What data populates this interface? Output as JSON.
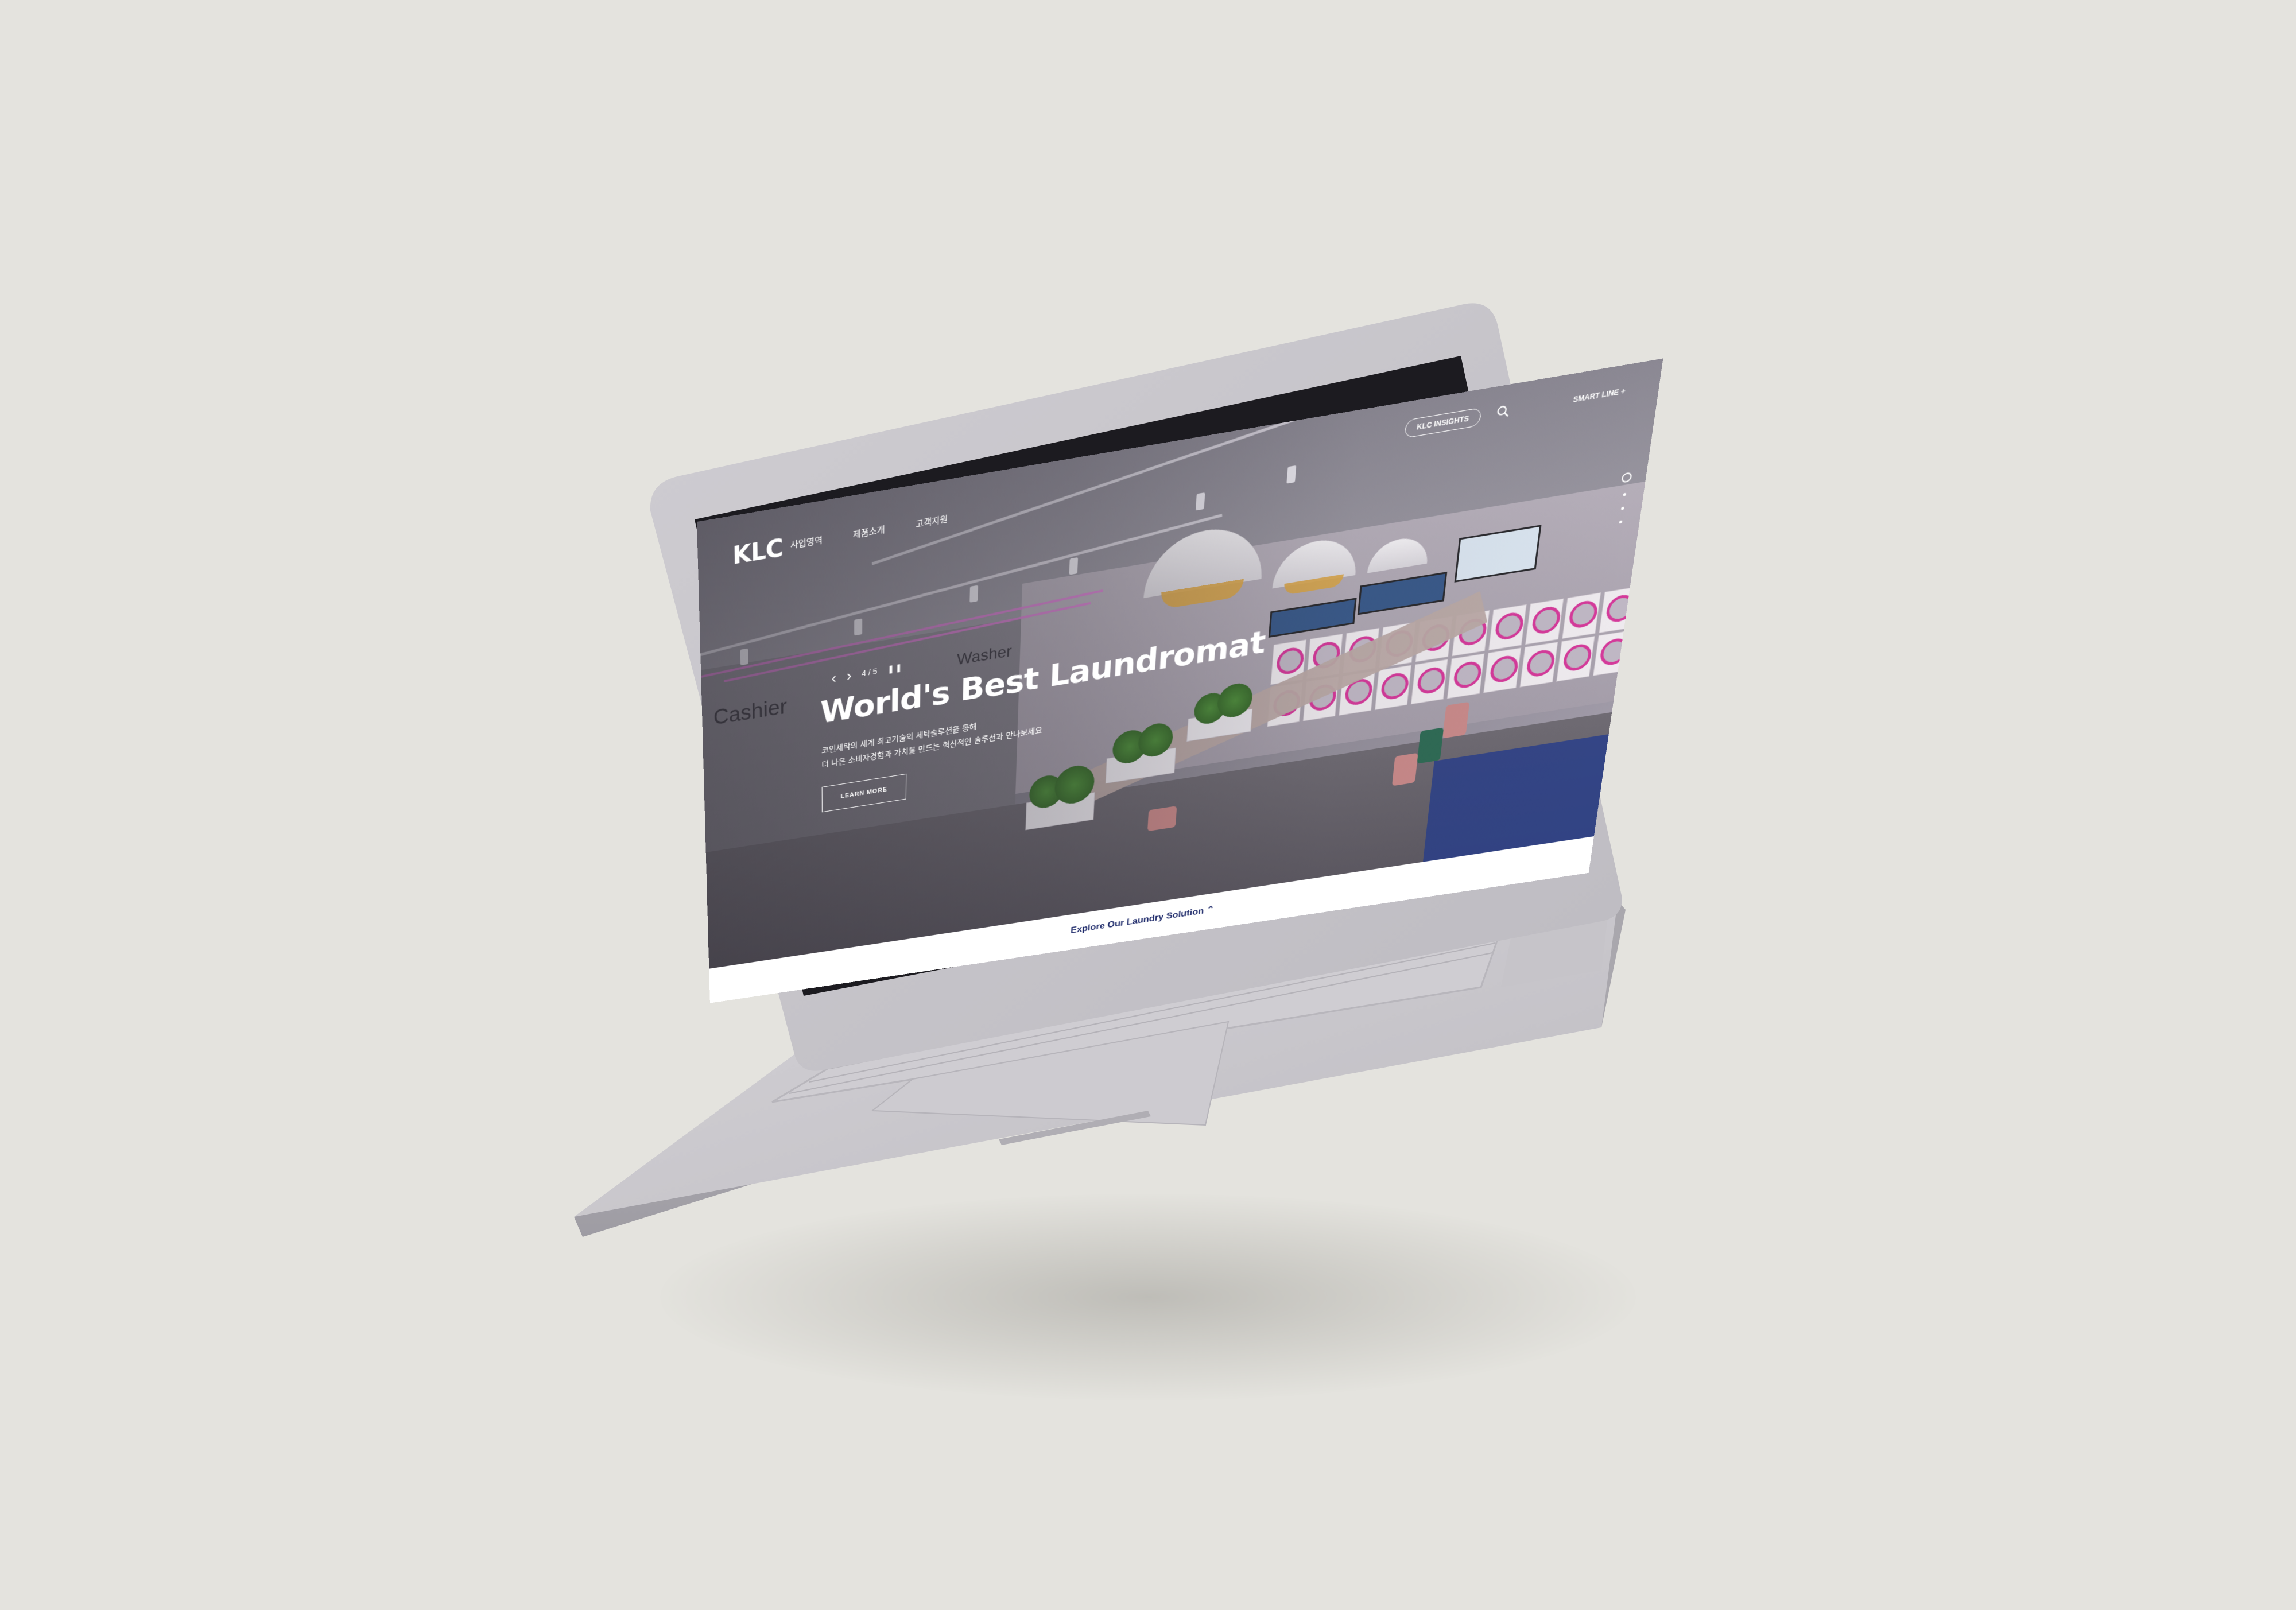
{
  "header": {
    "logo": "KLC",
    "nav": [
      "사업영역",
      "제품소개",
      "고객지원"
    ],
    "insights_label": "KLC INSIGHTS",
    "smartline_label": "SMART LINE +"
  },
  "slider": {
    "counter": "4 / 5",
    "prev_icon": "chevron-left-icon",
    "next_icon": "chevron-right-icon",
    "pause_icon": "pause-icon"
  },
  "hero": {
    "title": "World's Best Laundromat",
    "desc_line1": "코인세탁의 세계 최고기술의 세탁솔루션을 통해",
    "desc_line2": "더 나은 소비자경험과 가치를 만드는 혁신적인 솔루션과 만나보세요",
    "learn_more": "LEARN MORE"
  },
  "footer": {
    "explore_label": "Explore Our Laundry Solution",
    "explore_icon": "chevron-up-icon"
  },
  "colors": {
    "background": "#e4e3de",
    "device_body": "#c9c7cc",
    "accent_navy": "#1f2b6b",
    "neon_pink": "#d77ad0"
  }
}
